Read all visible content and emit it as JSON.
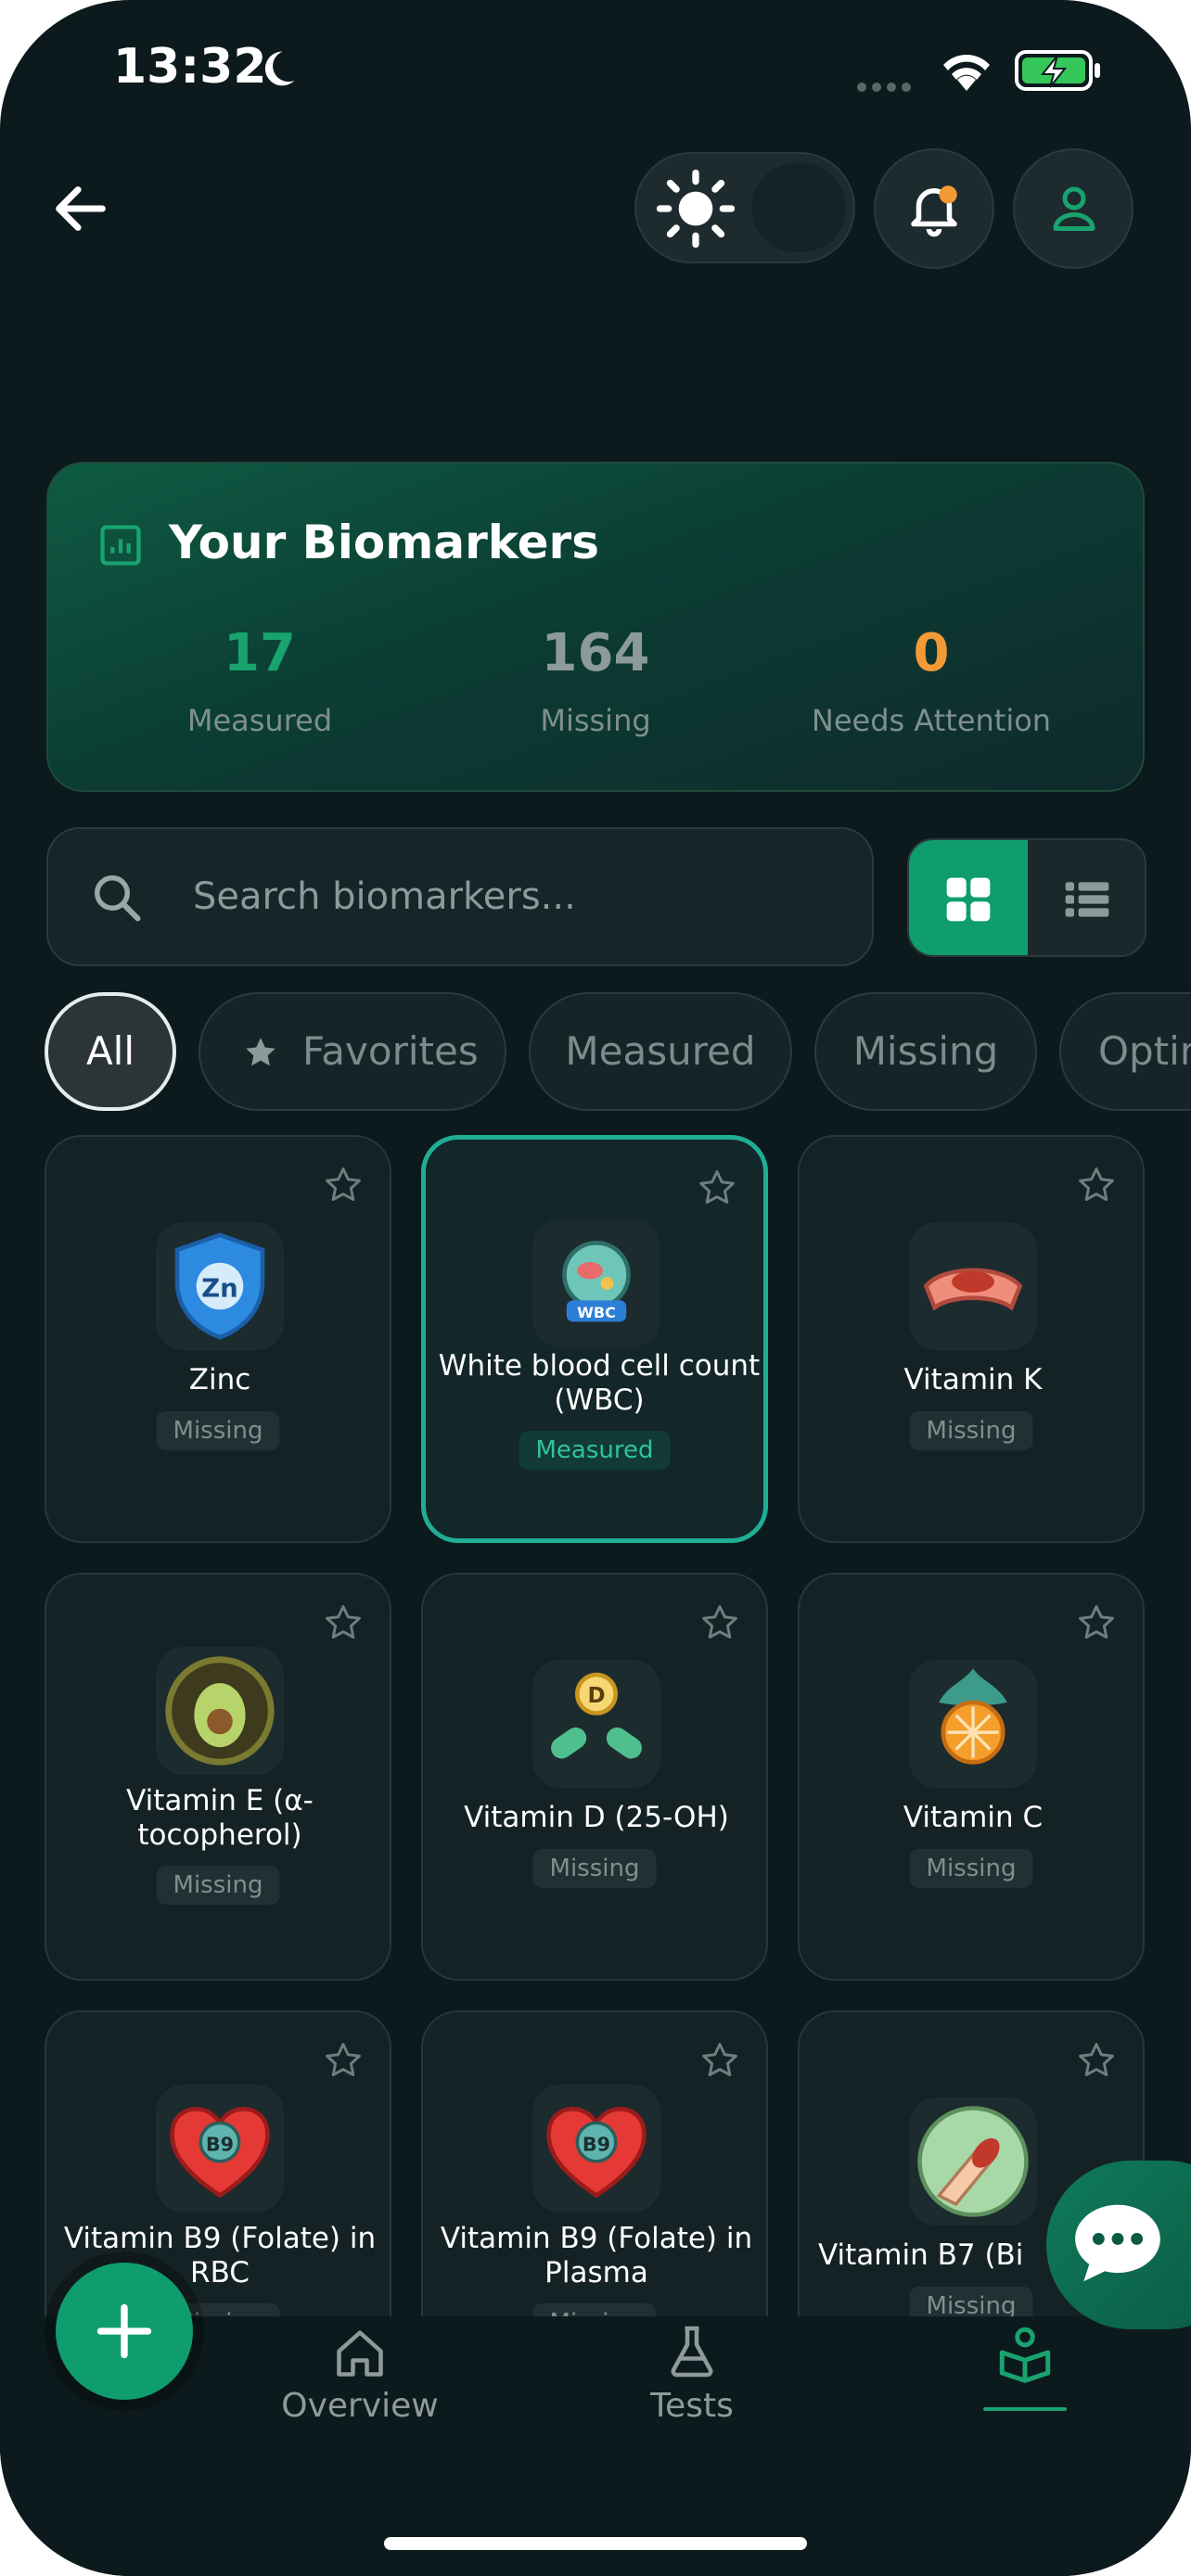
{
  "status_bar": {
    "time": "13:32"
  },
  "header": {},
  "summary": {
    "title": "Your Biomarkers",
    "stats": [
      {
        "value": "17",
        "label": "Measured",
        "color": "#18a36f"
      },
      {
        "value": "164",
        "label": "Missing",
        "color": "#8c9a9b"
      },
      {
        "value": "0",
        "label": "Needs Attention",
        "color": "#f39a35"
      }
    ]
  },
  "search": {
    "placeholder": "Search biomarkers..."
  },
  "filters": [
    "All",
    "Favorites",
    "Measured",
    "Missing",
    "Optin"
  ],
  "biomarkers": [
    {
      "name": "Zinc",
      "status": "Missing",
      "icon": "zinc-shield-icon"
    },
    {
      "name": "White blood cell count (WBC)",
      "status": "Measured",
      "icon": "wbc-cell-icon"
    },
    {
      "name": "Vitamin K",
      "status": "Missing",
      "icon": "vitamin-k-icon"
    },
    {
      "name": "Vitamin E (α-tocopherol)",
      "status": "Missing",
      "icon": "avocado-icon"
    },
    {
      "name": "Vitamin D (25-OH)",
      "status": "Missing",
      "icon": "sun-capsule-icon"
    },
    {
      "name": "Vitamin C",
      "status": "Missing",
      "icon": "orange-slice-icon"
    },
    {
      "name": "Vitamin B9 (Folate) in RBC",
      "status": "Missing",
      "icon": "heart-b9-icon"
    },
    {
      "name": "Vitamin B9 (Folate) in Plasma",
      "status": "Missing",
      "icon": "heart-b9-icon"
    },
    {
      "name": "Vitamin B7 (Bi",
      "status": "Missing",
      "icon": "nail-icon"
    }
  ],
  "nav": {
    "overview": "Overview",
    "tests": "Tests"
  },
  "colors": {
    "accent": "#0f9d6e",
    "selected_border": "#1fae94",
    "background": "#0d1a1d"
  }
}
